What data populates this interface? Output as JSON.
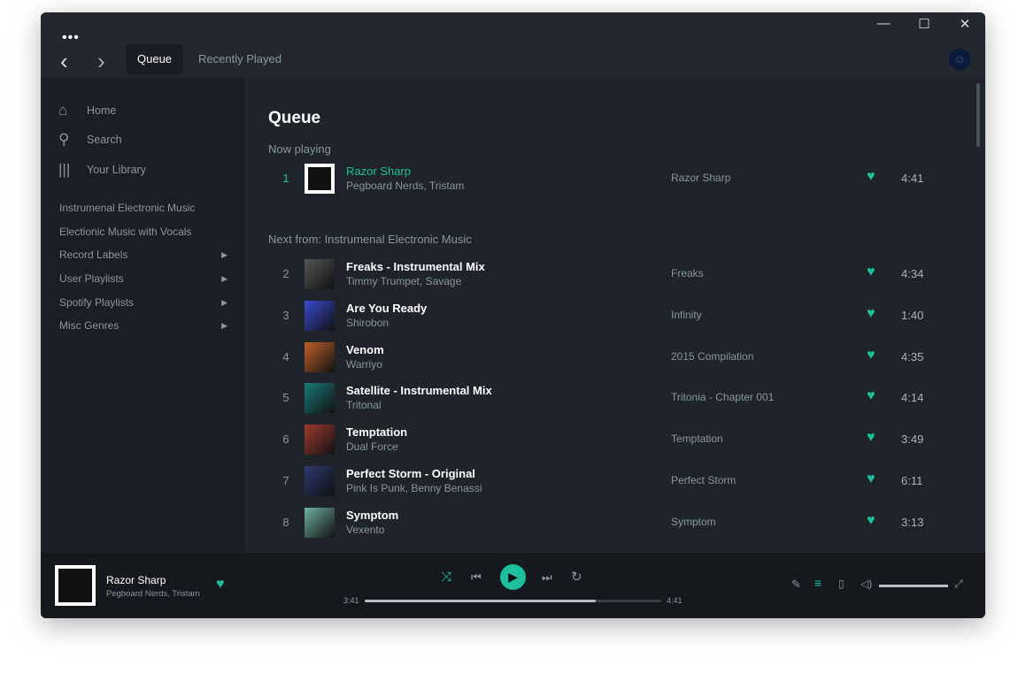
{
  "titlebar": {
    "menu_icon": "more-dots",
    "minimize": "—",
    "maximize": "☐",
    "close": "✕",
    "back": "‹",
    "forward": "›",
    "tabs": [
      {
        "label": "Queue",
        "active": true
      },
      {
        "label": "Recently Played",
        "active": false
      }
    ]
  },
  "sidebar": {
    "nav": [
      {
        "label": "Home",
        "icon": "home-icon"
      },
      {
        "label": "Search",
        "icon": "search-icon"
      },
      {
        "label": "Your Library",
        "icon": "library-icon"
      }
    ],
    "playlists": [
      {
        "label": "Instrumenal Electronic Music"
      },
      {
        "label": "Electionic Music with Vocals"
      },
      {
        "label": "Record Labels",
        "arrow": true
      },
      {
        "label": "User Playlists",
        "arrow": true
      },
      {
        "label": "Spotify Playlists",
        "arrow": true
      },
      {
        "label": "Misc Genres",
        "arrow": true
      }
    ]
  },
  "main": {
    "title": "Queue",
    "now_playing_label": "Now playing",
    "next_label": "Next from: Instrumenal Electronic Music",
    "now_playing": {
      "num": "1",
      "title": "Razor Sharp",
      "artist": "Pegboard Nerds, Tristam",
      "album": "Razor Sharp",
      "duration": "4:41"
    },
    "queue": [
      {
        "num": "2",
        "title": "Freaks - Instrumental Mix",
        "artist": "Timmy Trumpet, Savage",
        "album": "Freaks",
        "duration": "4:34",
        "color": "#555"
      },
      {
        "num": "3",
        "title": "Are You Ready",
        "artist": "Shirobon",
        "album": "Infinity",
        "duration": "1:40",
        "color": "#3a4bd0"
      },
      {
        "num": "4",
        "title": "Venom",
        "artist": "Warriyo",
        "album": "2015 Compilation",
        "duration": "4:35",
        "color": "#c0602a"
      },
      {
        "num": "5",
        "title": "Satellite - Instrumental Mix",
        "artist": "Tritonal",
        "album": "Tritonia - Chapter 001",
        "duration": "4:14",
        "color": "#1b7a7a"
      },
      {
        "num": "6",
        "title": "Temptation",
        "artist": "Dual Force",
        "album": "Temptation",
        "duration": "3:49",
        "color": "#a03a30"
      },
      {
        "num": "7",
        "title": "Perfect Storm - Original",
        "artist": "Pink Is Punk, Benny Benassi",
        "album": "Perfect Storm",
        "duration": "6:11",
        "color": "#2a3a70"
      },
      {
        "num": "8",
        "title": "Symptom",
        "artist": "Vexento",
        "album": "Symptom",
        "duration": "3:13",
        "color": "#6fb0a0"
      }
    ]
  },
  "player": {
    "title": "Razor Sharp",
    "artist": "Pegboard Nerds, Tristam",
    "elapsed": "3:41",
    "total": "4:41",
    "progress": 0.78,
    "volume": 1.0
  },
  "colors": {
    "accent": "#1dbf9f"
  }
}
